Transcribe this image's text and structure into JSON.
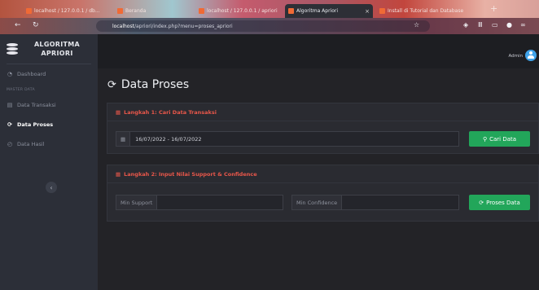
{
  "browser": {
    "tabs": [
      {
        "label": "localhost / 127.0.0.1 / db..."
      },
      {
        "label": "Beranda"
      },
      {
        "label": "localhost / 127.0.0.1 / apriori"
      },
      {
        "label": "Algoritma Apriori"
      },
      {
        "label": "Install di Tutorial dan Database"
      }
    ],
    "url_host": "localhost",
    "url_path": "/apriori/index.php?menu=proses_apriori"
  },
  "brand": {
    "title": "ALGORITMA APRIORI"
  },
  "sidebar": {
    "dashboard": "Dashboard",
    "section_heading": "MASTER DATA",
    "transaksi": "Data Transaksi",
    "proses": "Data Proses",
    "hasil": "Data Hasil"
  },
  "topnav": {
    "user": "Admin"
  },
  "page": {
    "title": "Data Proses"
  },
  "step1": {
    "heading": "Langkah 1: Cari Data Transaksi",
    "date_range": "16/07/2022 - 16/07/2022",
    "button": "Cari Data"
  },
  "step2": {
    "heading": "Langkah 2: Input Nilai Support & Confidence",
    "support_label": "Min Support",
    "support_value": "",
    "confidence_label": "Min Confidence",
    "confidence_value": "",
    "button": "Proses Data"
  },
  "colors": {
    "accent_green": "#22a65a",
    "heading_red": "#e9574a",
    "avatar_blue": "#3fa3ea"
  }
}
